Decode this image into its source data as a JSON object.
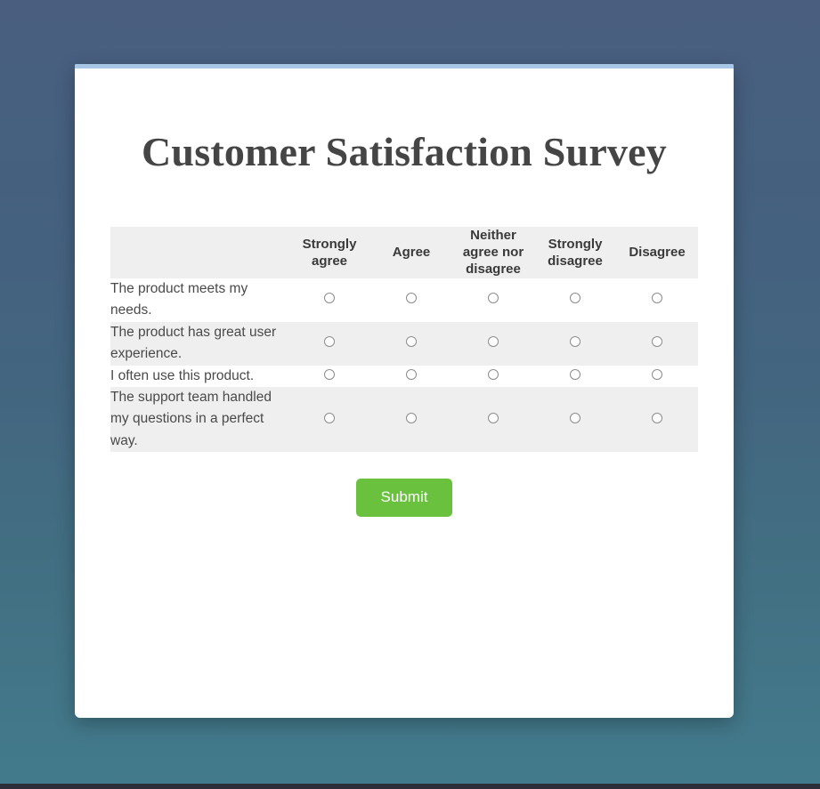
{
  "page": {
    "title": "Customer Satisfaction Survey",
    "accent_color": "#a8c6e5",
    "background_top_color": "#4a5f80",
    "background_bottom_color": "#427b8c"
  },
  "survey": {
    "columns": [
      "Strongly agree",
      "Agree",
      "Neither agree nor disagree",
      "Strongly disagree",
      "Disagree"
    ],
    "rows": [
      {
        "question": "The product meets my needs.",
        "selected": null
      },
      {
        "question": "The product has great user experience.",
        "selected": null
      },
      {
        "question": "I often use this product.",
        "selected": null
      },
      {
        "question": "The support team handled my questions in a perfect way.",
        "selected": null
      }
    ]
  },
  "actions": {
    "submit_label": "Submit",
    "submit_color": "#69c13d"
  }
}
